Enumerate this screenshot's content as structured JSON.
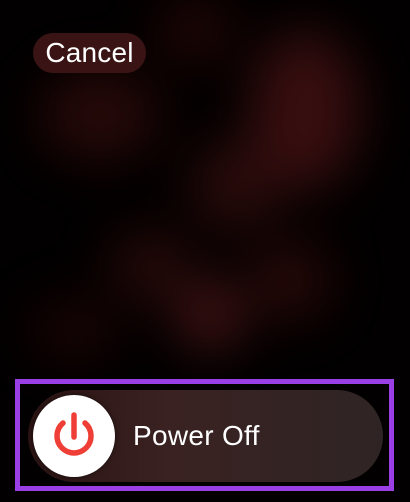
{
  "cancel": {
    "label": "Cancel"
  },
  "power_slider": {
    "label": "Power Off",
    "knob_icon": "power-icon",
    "icon_color": "#ef3e36",
    "progress": 0
  },
  "colors": {
    "background": "#020000",
    "highlight_border": "#9a3ee6",
    "track": "#2f1a1a"
  }
}
